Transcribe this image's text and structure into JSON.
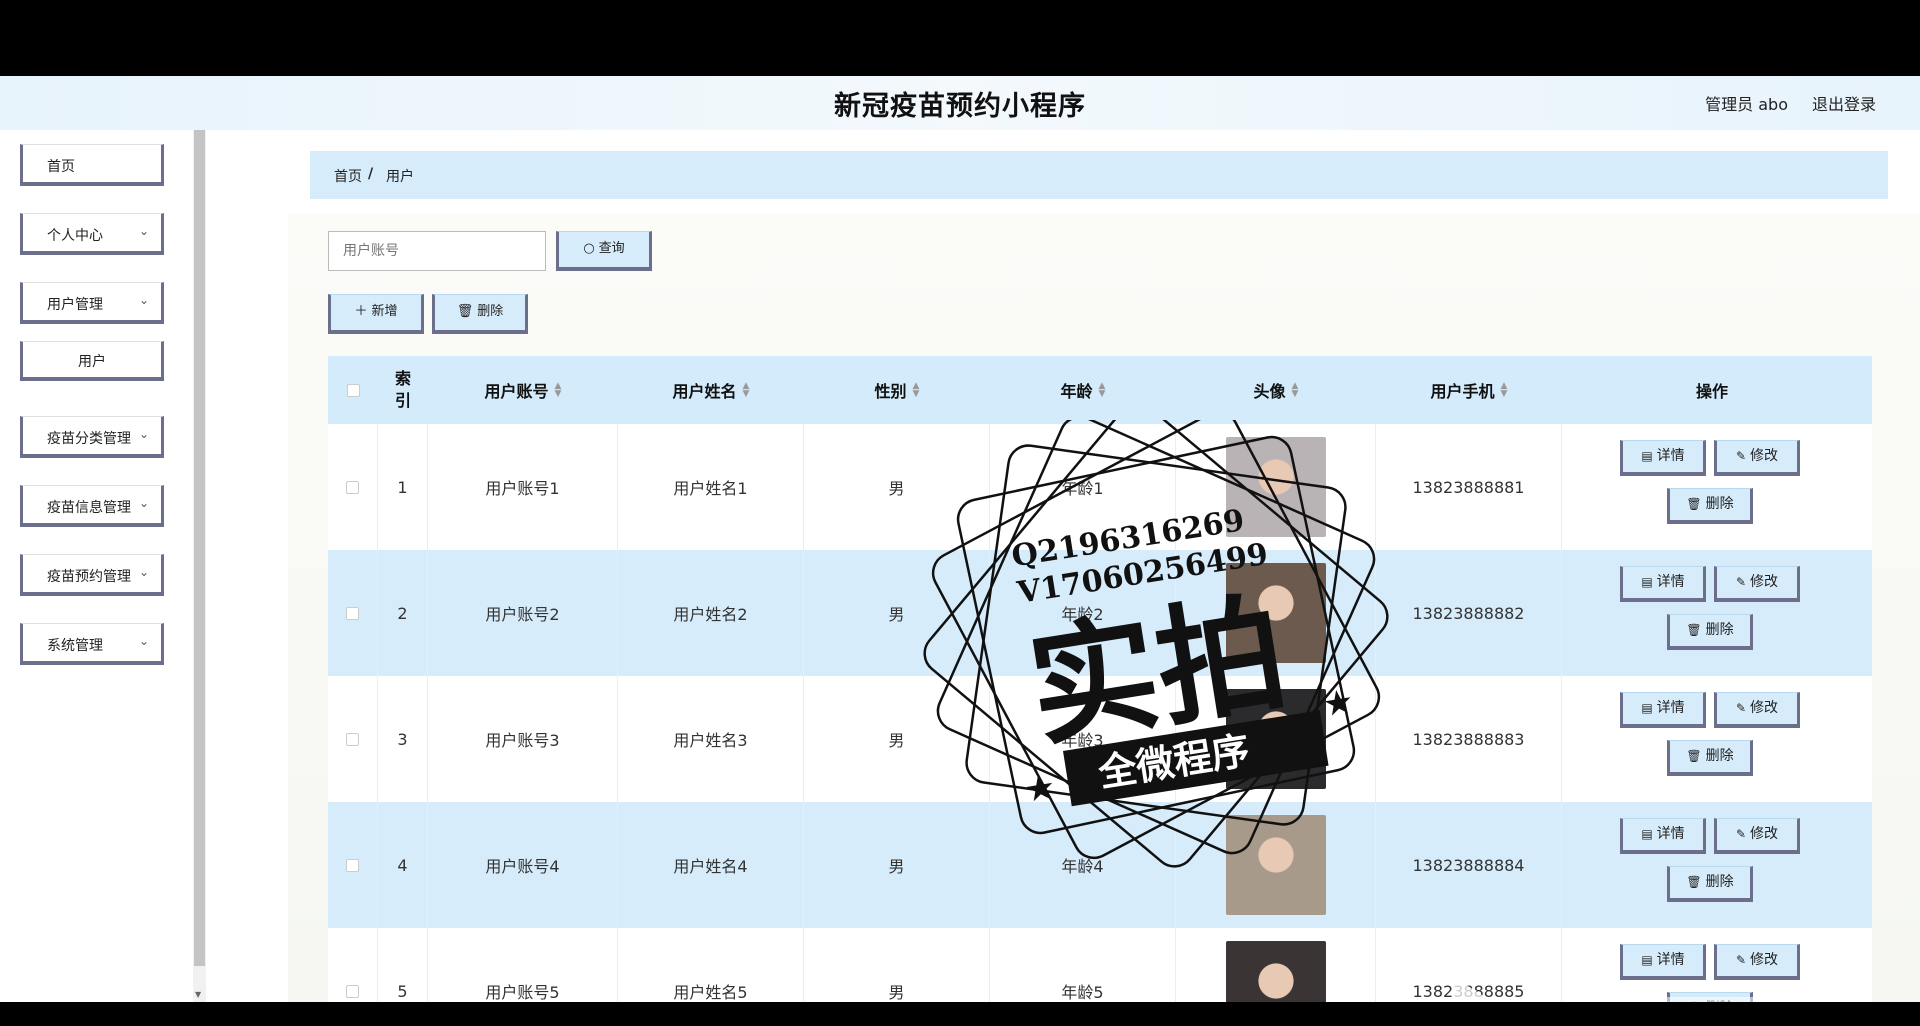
{
  "app": {
    "title": "新冠疫苗预约小程序",
    "user_label": "管理员 abo",
    "logout_label": "退出登录"
  },
  "sidebar": {
    "items": [
      {
        "label": "首页"
      },
      {
        "label": "个人中心",
        "chevron": "chevron-down-icon"
      },
      {
        "label": "用户管理",
        "chevron": "chevron-down-icon"
      },
      {
        "label": "用户",
        "sub": true
      },
      {
        "label": "疫苗分类管理",
        "chevron": "chevron-down-icon"
      },
      {
        "label": "疫苗信息管理",
        "chevron": "chevron-down-icon"
      },
      {
        "label": "疫苗预约管理",
        "chevron": "chevron-down-icon"
      },
      {
        "label": "系统管理",
        "chevron": "chevron-down-icon"
      }
    ]
  },
  "breadcrumb": {
    "home": "首页",
    "separator": "/",
    "current": "用户"
  },
  "search": {
    "placeholder": "用户账号",
    "button_label": "查询",
    "button_icon": "search-icon"
  },
  "toolbar": {
    "add_label": "新增",
    "add_icon": "plus-icon",
    "delete_label": "删除",
    "delete_icon": "trash-icon"
  },
  "table": {
    "headers": {
      "index": "索\n引",
      "account": "用户账号",
      "name": "用户姓名",
      "gender": "性别",
      "age": "年龄",
      "avatar": "头像",
      "phone": "用户手机",
      "ops": "操作"
    },
    "rows": [
      {
        "index": "1",
        "account": "用户账号1",
        "name": "用户姓名1",
        "gender": "男",
        "age": "年龄1",
        "phone": "13823888881",
        "avatar_tone": "#b9b3b5"
      },
      {
        "index": "2",
        "account": "用户账号2",
        "name": "用户姓名2",
        "gender": "男",
        "age": "年龄2",
        "phone": "13823888882",
        "avatar_tone": "#6b5a4d"
      },
      {
        "index": "3",
        "account": "用户账号3",
        "name": "用户姓名3",
        "gender": "男",
        "age": "年龄3",
        "phone": "13823888883",
        "avatar_tone": "#2b2b2d"
      },
      {
        "index": "4",
        "account": "用户账号4",
        "name": "用户姓名4",
        "gender": "男",
        "age": "年龄4",
        "phone": "13823888884",
        "avatar_tone": "#a89a8a"
      },
      {
        "index": "5",
        "account": "用户账号5",
        "name": "用户姓名5",
        "gender": "男",
        "age": "年龄5",
        "phone": "13823888885",
        "avatar_tone": "#3a3434"
      }
    ],
    "op_labels": {
      "detail": "详情",
      "edit": "修改",
      "delete": "删除"
    },
    "op_icons": {
      "detail": "document-icon",
      "edit": "pencil-icon",
      "delete": "trash-icon"
    }
  },
  "watermark": {
    "line1": "Q2196316269",
    "line2": "V17060256499",
    "big": "实拍",
    "band": "全微程序"
  },
  "colors": {
    "accent": "#d6ecfb",
    "border": "#6b6f8c",
    "header_bg": "#e7f3fb"
  }
}
